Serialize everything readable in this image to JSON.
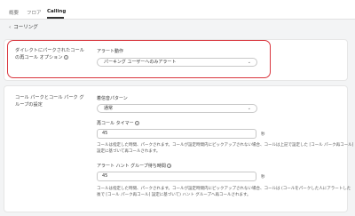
{
  "tabs": [
    {
      "label": "概要"
    },
    {
      "label": "フロア"
    },
    {
      "label": "Calling"
    }
  ],
  "breadcrumb": {
    "back_label": "コーリング",
    "back_icon": "chevron-left-icon"
  },
  "direct_park": {
    "section_label": "ダイレクトにパークされたコールの再コール オプション",
    "alert_action_label": "アラート動作",
    "alert_action_value": "パーキング ユーザーへのみアラート"
  },
  "park_group": {
    "section_label": "コール パークとコール パーク グループの設定",
    "ring_pattern_label": "着信音パターン",
    "ring_pattern_value": "通常",
    "recall_timer_label": "再コール タイマー",
    "recall_timer_value": "45",
    "recall_timer_unit": "秒",
    "recall_timer_help": "コールは指定した時間、パークされます。コールが設定時間内にピックアップされない場合、コールは上記で設定した [コール パーク再コール] 設定に基づいて再コールされます。",
    "hunt_wait_label": "アラート ハント グループ待ち時間",
    "hunt_wait_value": "45",
    "hunt_wait_unit": "秒",
    "hunt_wait_help": "コールは指定した時間、パークされます。コールが設定時間内にピックアップされない場合、コールは (コールをパークした人にアラートした後で [コール パーク再コール] 設定に基づいて) ハント グループへ再コールされます。"
  },
  "colors": {
    "highlight": "#d9363e",
    "background": "#f3f4f5"
  }
}
